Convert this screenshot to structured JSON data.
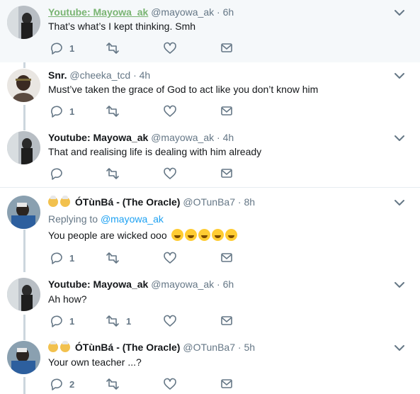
{
  "tweets": [
    {
      "name": "Youtube: Mayowa_ak",
      "handle": "@mayowa_ak",
      "dot": "·",
      "time": "6h",
      "text": "That’s what’s I kept thinking. Smh",
      "reply_count": "1",
      "retweet_count": "",
      "highlight": true
    },
    {
      "name": "Snr.",
      "handle": "@cheeka_tcd",
      "dot": "·",
      "time": "4h",
      "text": "Must’ve taken the grace of God to act like you don’t know him",
      "reply_count": "1",
      "retweet_count": ""
    },
    {
      "name": "Youtube: Mayowa_ak",
      "handle": "@mayowa_ak",
      "dot": "·",
      "time": "4h",
      "text": "That and realising life is dealing with him already",
      "reply_count": "",
      "retweet_count": ""
    },
    {
      "name": "ÓTùnBá - (The Oracle)",
      "handle": "@OTunBa7",
      "dot": "·",
      "time": "8h",
      "reply_prefix": "Replying to",
      "reply_mention": "@mayowa_ak",
      "text": "You people are wicked ooo",
      "reply_count": "1",
      "retweet_count": ""
    },
    {
      "name": "Youtube: Mayowa_ak",
      "handle": "@mayowa_ak",
      "dot": "·",
      "time": "6h",
      "text": "Ah how?",
      "reply_count": "1",
      "retweet_count": "1"
    },
    {
      "name": "ÓTùnBá - (The Oracle)",
      "handle": "@OTunBa7",
      "dot": "·",
      "time": "5h",
      "text": "Your own teacher ...?",
      "reply_count": "2",
      "retweet_count": ""
    }
  ],
  "icons": {
    "reply": "reply-icon",
    "retweet": "retweet-icon",
    "like": "heart-icon",
    "dm": "envelope-icon",
    "more": "chevron-down-icon"
  },
  "colors": {
    "link_green": "#79b472",
    "mention_blue": "#1da1f2",
    "muted": "#657786",
    "highlight_bg": "#f5f8fa"
  }
}
